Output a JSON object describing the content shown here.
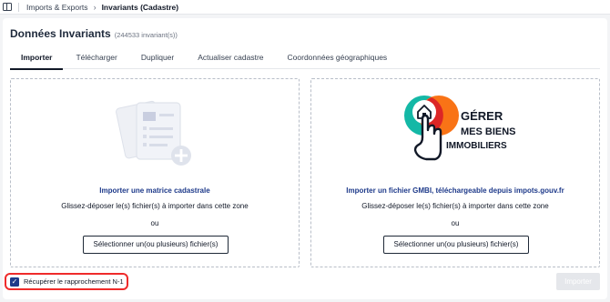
{
  "breadcrumb": {
    "parent": "Imports & Exports",
    "current": "Invariants (Cadastre)"
  },
  "page": {
    "title": "Données Invariants",
    "count": "(244533 invariant(s))"
  },
  "tabs": [
    {
      "label": "Importer",
      "active": true
    },
    {
      "label": "Télécharger",
      "active": false
    },
    {
      "label": "Dupliquer",
      "active": false
    },
    {
      "label": "Actualiser cadastre",
      "active": false
    },
    {
      "label": "Coordonnées géographiques",
      "active": false
    }
  ],
  "left_zone": {
    "title": "Importer une matrice cadastrale",
    "hint": "Glissez-déposer le(s) fichier(s) à importer dans cette zone",
    "or": "ou",
    "button": "Sélectionner un(ou plusieurs) fichier(s)"
  },
  "right_zone": {
    "logo_text": [
      "GÉRER",
      "MES BIENS",
      "IMMOBILIERS"
    ],
    "title": "Importer un fichier GMBI, téléchargeable depuis impots.gouv.fr",
    "hint": "Glissez-déposer le(s) fichier(s) à importer dans cette zone",
    "or": "ou",
    "button": "Sélectionner un(ou plusieurs) fichier(s)"
  },
  "option": {
    "label": "Récupérer le rapprochement N-1",
    "checked": true
  },
  "import_button": "Importer",
  "colors": {
    "accent": "#1e3a8a",
    "highlight": "#ef2b2b",
    "logo_teal": "#14b8a6",
    "logo_orange": "#f97316",
    "logo_red": "#dc2626"
  }
}
